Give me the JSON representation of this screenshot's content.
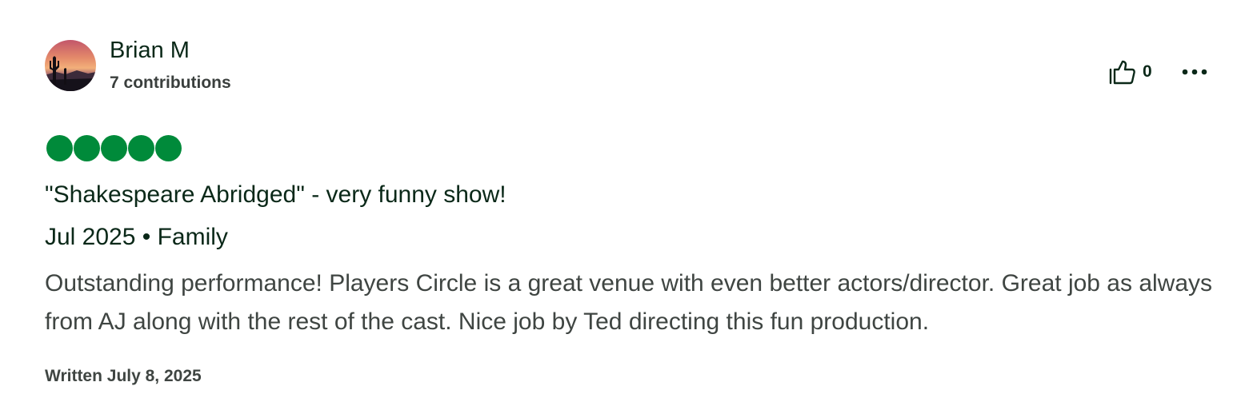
{
  "review": {
    "author": {
      "name": "Brian M",
      "contributions": "7 contributions",
      "avatar_icon": "desert-sunset-avatar"
    },
    "helpful": {
      "icon": "thumbs-up-icon",
      "count": "0"
    },
    "more_icon": "more-options-icon",
    "rating": {
      "value": 5,
      "max": 5,
      "color": "#008a3a"
    },
    "title": "\"Shakespeare Abridged\" - very funny show!",
    "meta": "Jul 2025 • Family",
    "body": "Outstanding performance! Players Circle is a great venue with even better actors/director. Great job as always from AJ along with the rest of the cast. Nice job by Ted directing this fun production.",
    "written": "Written July 8, 2025"
  }
}
